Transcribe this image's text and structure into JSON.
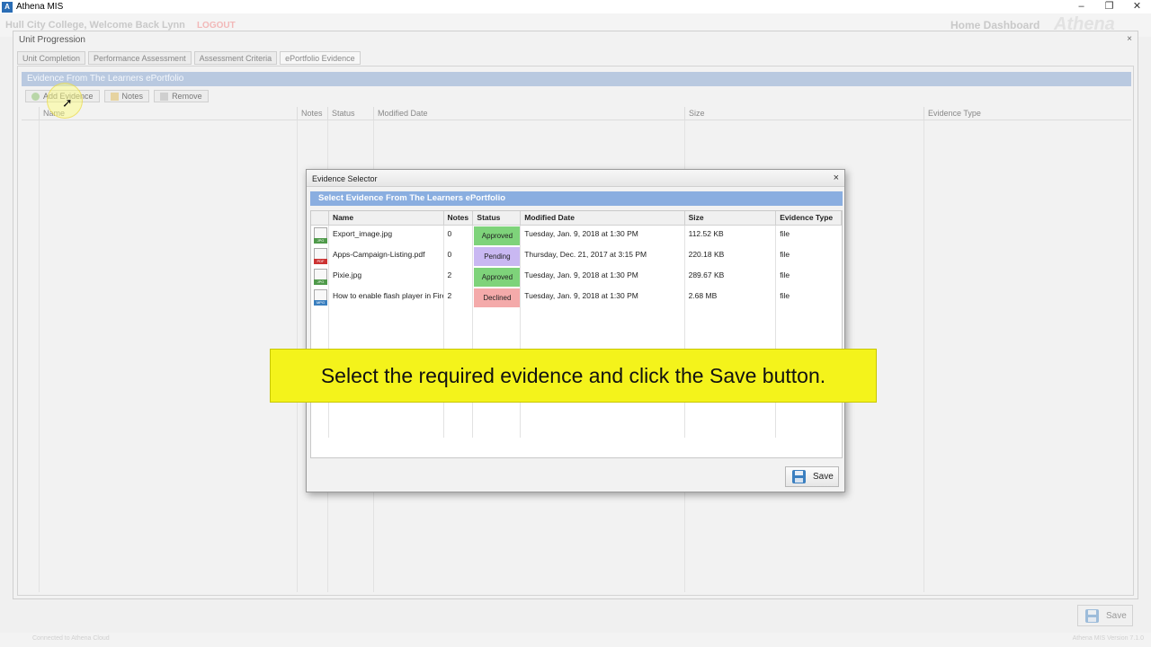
{
  "window": {
    "app_title": "Athena MIS",
    "controls": [
      "–",
      "❐",
      "✕"
    ]
  },
  "header": {
    "college": "Hull City College,  Welcome Back Lynn",
    "logout": "LOGOUT",
    "home_dashboard": "Home Dashboard",
    "brand": "Athena"
  },
  "unit_window": {
    "title": "Unit Progression",
    "close": "×",
    "tabs": [
      "Unit Completion",
      "Performance Assessment",
      "Assessment Criteria",
      "ePortfolio Evidence"
    ],
    "active_tab": 3,
    "panel_header": "Evidence From The Learners ePortfolio",
    "toolbar": {
      "add_evidence": "Add Evidence",
      "notes": "Notes",
      "remove": "Remove"
    },
    "columns": [
      "Name",
      "Notes",
      "Status",
      "Modified Date",
      "Size",
      "Evidence Type"
    ]
  },
  "dialog": {
    "title": "Evidence Selector",
    "close": "×",
    "header": "Select Evidence From The Learners ePortfolio",
    "columns": [
      "Name",
      "Notes",
      "Status",
      "Modified Date",
      "Size",
      "Evidence Type"
    ],
    "rows": [
      {
        "icon": "jpg",
        "icon_label": "JPG",
        "name": "Export_image.jpg",
        "notes": "0",
        "status": "Approved",
        "status_class": "approved",
        "date": "Tuesday, Jan. 9, 2018 at 1:30 PM",
        "size": "112.52 KB",
        "type": "file"
      },
      {
        "icon": "pdf",
        "icon_label": "PDF",
        "name": "Apps-Campaign-Listing.pdf",
        "notes": "0",
        "status": "Pending",
        "status_class": "pending",
        "date": "Thursday, Dec. 21, 2017 at 3:15 PM",
        "size": "220.18 KB",
        "type": "file"
      },
      {
        "icon": "jpg",
        "icon_label": "JPG",
        "name": "Pixie.jpg",
        "notes": "2",
        "status": "Approved",
        "status_class": "approved",
        "date": "Tuesday, Jan. 9, 2018 at 1:30 PM",
        "size": "289.67 KB",
        "type": "file"
      },
      {
        "icon": "mpg",
        "icon_label": "MPG",
        "name": "How to enable flash player in Fire",
        "notes": "2",
        "status": "Declined",
        "status_class": "declined",
        "date": "Tuesday, Jan. 9, 2018 at 1:30 PM",
        "size": "2.68 MB",
        "type": "file"
      }
    ],
    "save_label": "Save"
  },
  "caption": "Select the required evidence and click the Save button.",
  "footer": {
    "save_label": "Save",
    "status_left": "Connected to Athena Cloud",
    "status_right": "Athena MIS Version 7.1.0"
  },
  "colors": {
    "approved": "#7ed37a",
    "pending": "#c9b8f2",
    "declined": "#f4aaaa",
    "dialog_header": "#8aaee0",
    "caption": "#f4f31b"
  }
}
